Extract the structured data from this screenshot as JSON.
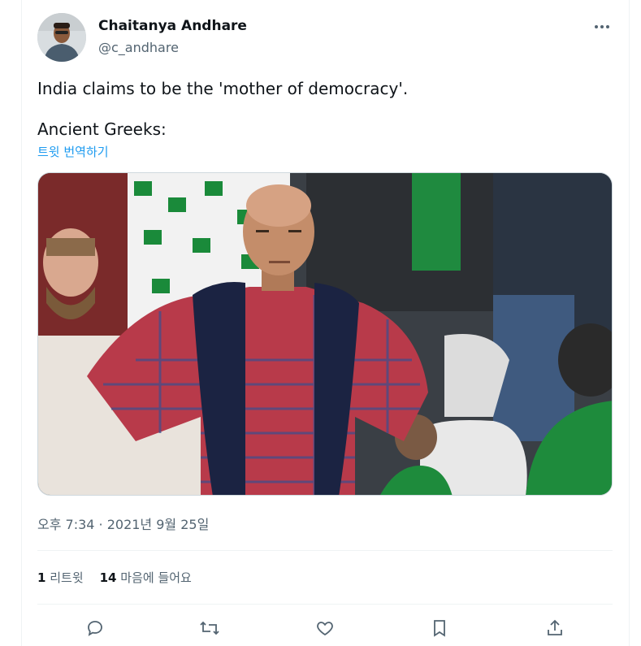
{
  "tweet": {
    "author_name": "Chaitanya Andhare",
    "author_handle": "@c_andhare",
    "text_line_1": "India claims to be the 'mother of democracy'.",
    "text_line_2": "Ancient Greeks:",
    "translate_label": "트윗 번역하기",
    "timestamp": "오후 7:34 · 2021년 9월 25일"
  },
  "stats": {
    "retweets_count": "1",
    "retweets_label": "리트윗",
    "likes_count": "14",
    "likes_label": "마음에 들어요"
  },
  "colors": {
    "link": "#1d9bf0",
    "secondary_text": "#536471",
    "divider": "#eff3f4"
  },
  "icons": {
    "more": "more-dots-icon",
    "reply": "reply-icon",
    "retweet": "retweet-icon",
    "like": "heart-icon",
    "bookmark": "bookmark-icon",
    "share": "share-icon"
  }
}
